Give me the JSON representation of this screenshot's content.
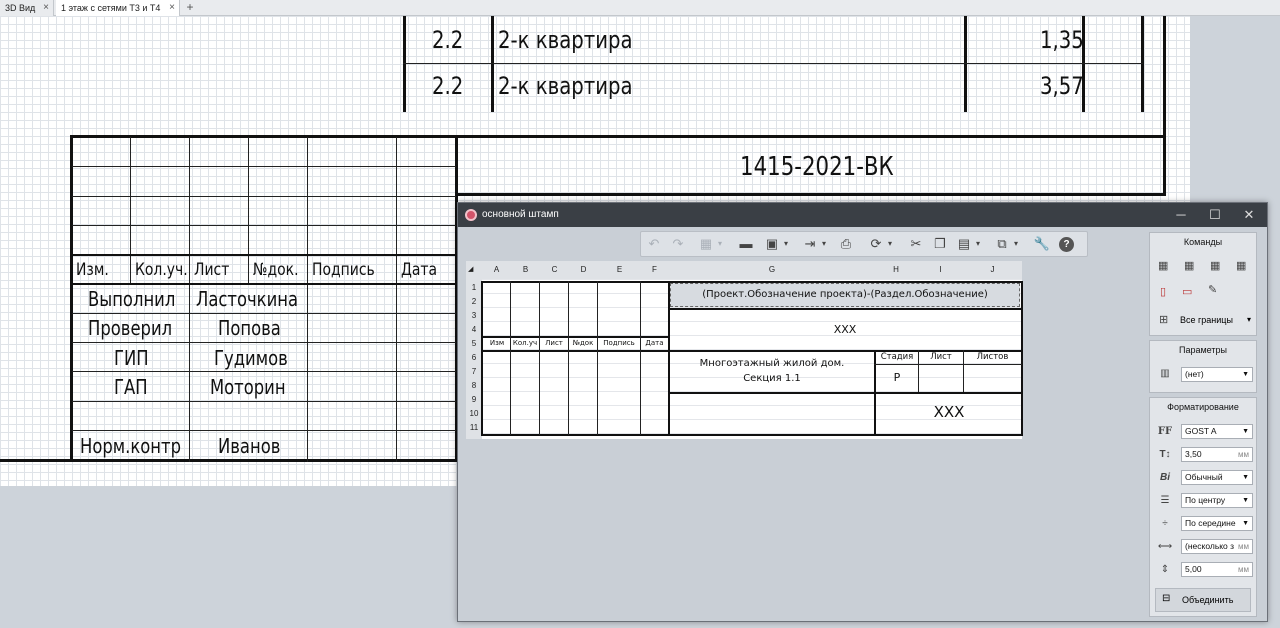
{
  "tabs": [
    {
      "label": "3D Вид"
    },
    {
      "label": "1 этаж с сетями Т3 и Т4"
    }
  ],
  "tab_close": "×",
  "tab_add": "+",
  "schedule": {
    "rows": [
      {
        "num": "2.2",
        "name": "2-к квартира",
        "value": "1,35"
      },
      {
        "num": "2.2",
        "name": "2-к квартира",
        "value": "3,57"
      }
    ]
  },
  "titleblock": {
    "code": "1415-2021-ВК",
    "headers": [
      "Изм.",
      "Кол.уч.",
      "Лист",
      "№док.",
      "Подпись",
      "Дата"
    ],
    "roles": [
      {
        "role": "Выполнил",
        "name": "Ласточкина"
      },
      {
        "role": "Проверил",
        "name": "Попова"
      },
      {
        "role": "ГИП",
        "name": "Гудимов"
      },
      {
        "role": "ГАП",
        "name": "Моторин"
      },
      {
        "role": "",
        "name": ""
      },
      {
        "role": "Норм.контр",
        "name": "Иванов"
      }
    ]
  },
  "dialog": {
    "title": "основной штамп",
    "window_controls": {
      "minimize": "─",
      "maximize": "☐",
      "close": "✕"
    },
    "toolbar": [
      "undo-icon",
      "redo-icon",
      "box-icon",
      "folder-icon",
      "save-icon",
      "export-icon",
      "print-icon",
      "refresh-icon",
      "cut-icon",
      "copy-icon",
      "paste-icon",
      "layers-icon",
      "wrench-icon",
      "help-icon"
    ],
    "columns": [
      "A",
      "B",
      "C",
      "D",
      "E",
      "F",
      "G",
      "H",
      "I",
      "J"
    ],
    "rows": [
      "1",
      "2",
      "3",
      "4",
      "5",
      "6",
      "7",
      "8",
      "9",
      "10",
      "11"
    ],
    "cells": {
      "headers": [
        "Изм",
        "Кол.уч",
        "Лист",
        "№док",
        "Подпись",
        "Дата"
      ],
      "formula": "(Проект.Обозначение проекта)-(Раздел.Обозначение)",
      "xxx1": "XXX",
      "building_line1": "Многоэтажный жилой дом.",
      "building_line2": "Секция 1.1",
      "stage_h": "Стадия",
      "sheet_h": "Лист",
      "sheets_h": "Листов",
      "stage": "Р",
      "xxx2": "XXX"
    },
    "panel": {
      "commands_title": "Команды",
      "borders": "Все границы",
      "params_title": "Параметры",
      "params_value": "(нет)",
      "format_title": "Форматирование",
      "font": "GOST A",
      "size": "3,50",
      "size_unit": "мм",
      "style": "Обычный",
      "halign": "По центру",
      "valign": "По середине",
      "spacing": "(несколько з",
      "spacing_unit": "мм",
      "indent": "5,00",
      "indent_unit": "мм",
      "merge": "Объединить"
    }
  }
}
